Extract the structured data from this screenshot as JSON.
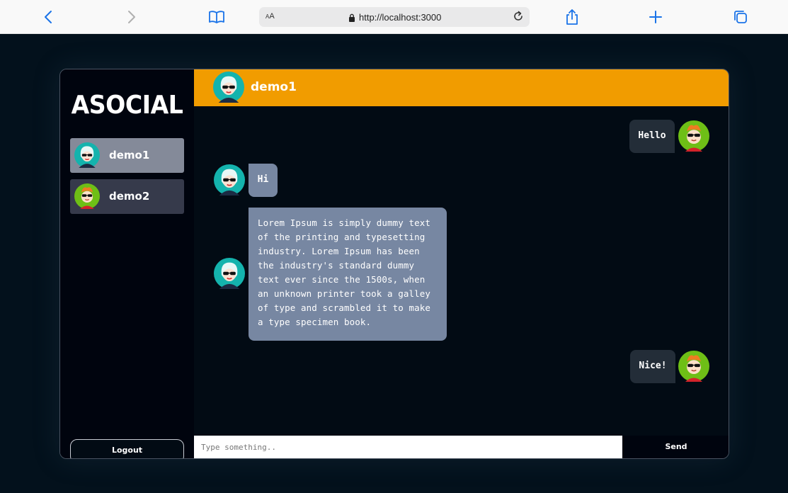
{
  "browser": {
    "text_size_label": "AA",
    "url": "http://localhost:3000"
  },
  "app": {
    "brand": "ASOCIAL",
    "contacts": [
      {
        "name": "demo1",
        "avatar": "teal-avatar",
        "active": true
      },
      {
        "name": "demo2",
        "avatar": "orange-avatar",
        "active": false
      }
    ],
    "logout_label": "Logout"
  },
  "chat": {
    "header_name": "demo1",
    "messages": [
      {
        "direction": "outgoing",
        "text": "Hello",
        "avatar": "orange-avatar"
      },
      {
        "direction": "incoming",
        "text": "Hi",
        "avatar": "teal-avatar"
      },
      {
        "direction": "incoming",
        "text": "Lorem Ipsum is simply dummy text of the printing and typesetting industry. Lorem Ipsum has been the industry's standard dummy text ever since the 1500s, when an unknown printer took a galley of type and scrambled it to make a type specimen book.",
        "avatar": "teal-avatar"
      },
      {
        "direction": "outgoing",
        "text": "Nice!",
        "avatar": "orange-avatar"
      }
    ],
    "composer": {
      "placeholder": "Type something..",
      "value": "",
      "send_label": "Send"
    }
  },
  "colors": {
    "header": "#f19c00",
    "incoming_bubble": "#7787a2",
    "outgoing_bubble": "#232d38",
    "active_contact": "#848a99",
    "inactive_contact": "#363a4b"
  }
}
